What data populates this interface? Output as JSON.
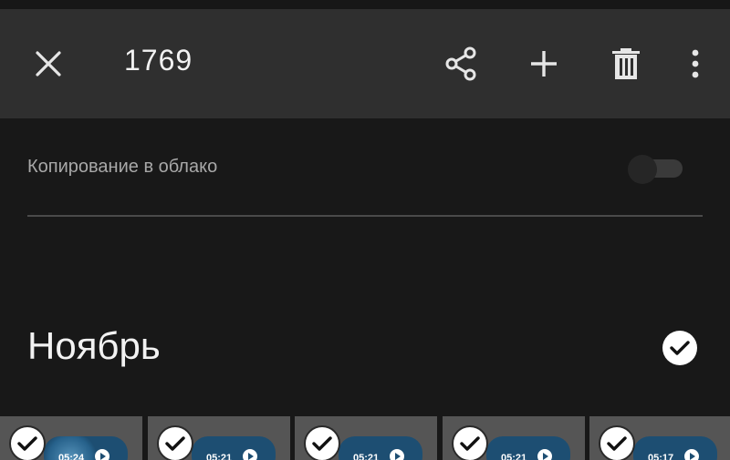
{
  "toolbar": {
    "selected_count": "1769",
    "icons": [
      "close-icon",
      "share-icon",
      "add-icon",
      "delete-icon",
      "more-vert-icon"
    ]
  },
  "backup": {
    "label": "Копирование в облако",
    "enabled": false
  },
  "section": {
    "month": "Ноябрь",
    "all_selected": true
  },
  "thumbnails": [
    {
      "duration": "05:24",
      "selected": true
    },
    {
      "duration": "05:21",
      "selected": true
    },
    {
      "duration": "05:21",
      "selected": true
    },
    {
      "duration": "05:21",
      "selected": true
    },
    {
      "duration": "05:17",
      "selected": true
    }
  ],
  "colors": {
    "toolbar_bg": "#2f2f2f",
    "page_bg": "#181818",
    "check_bg": "#ffffff"
  }
}
